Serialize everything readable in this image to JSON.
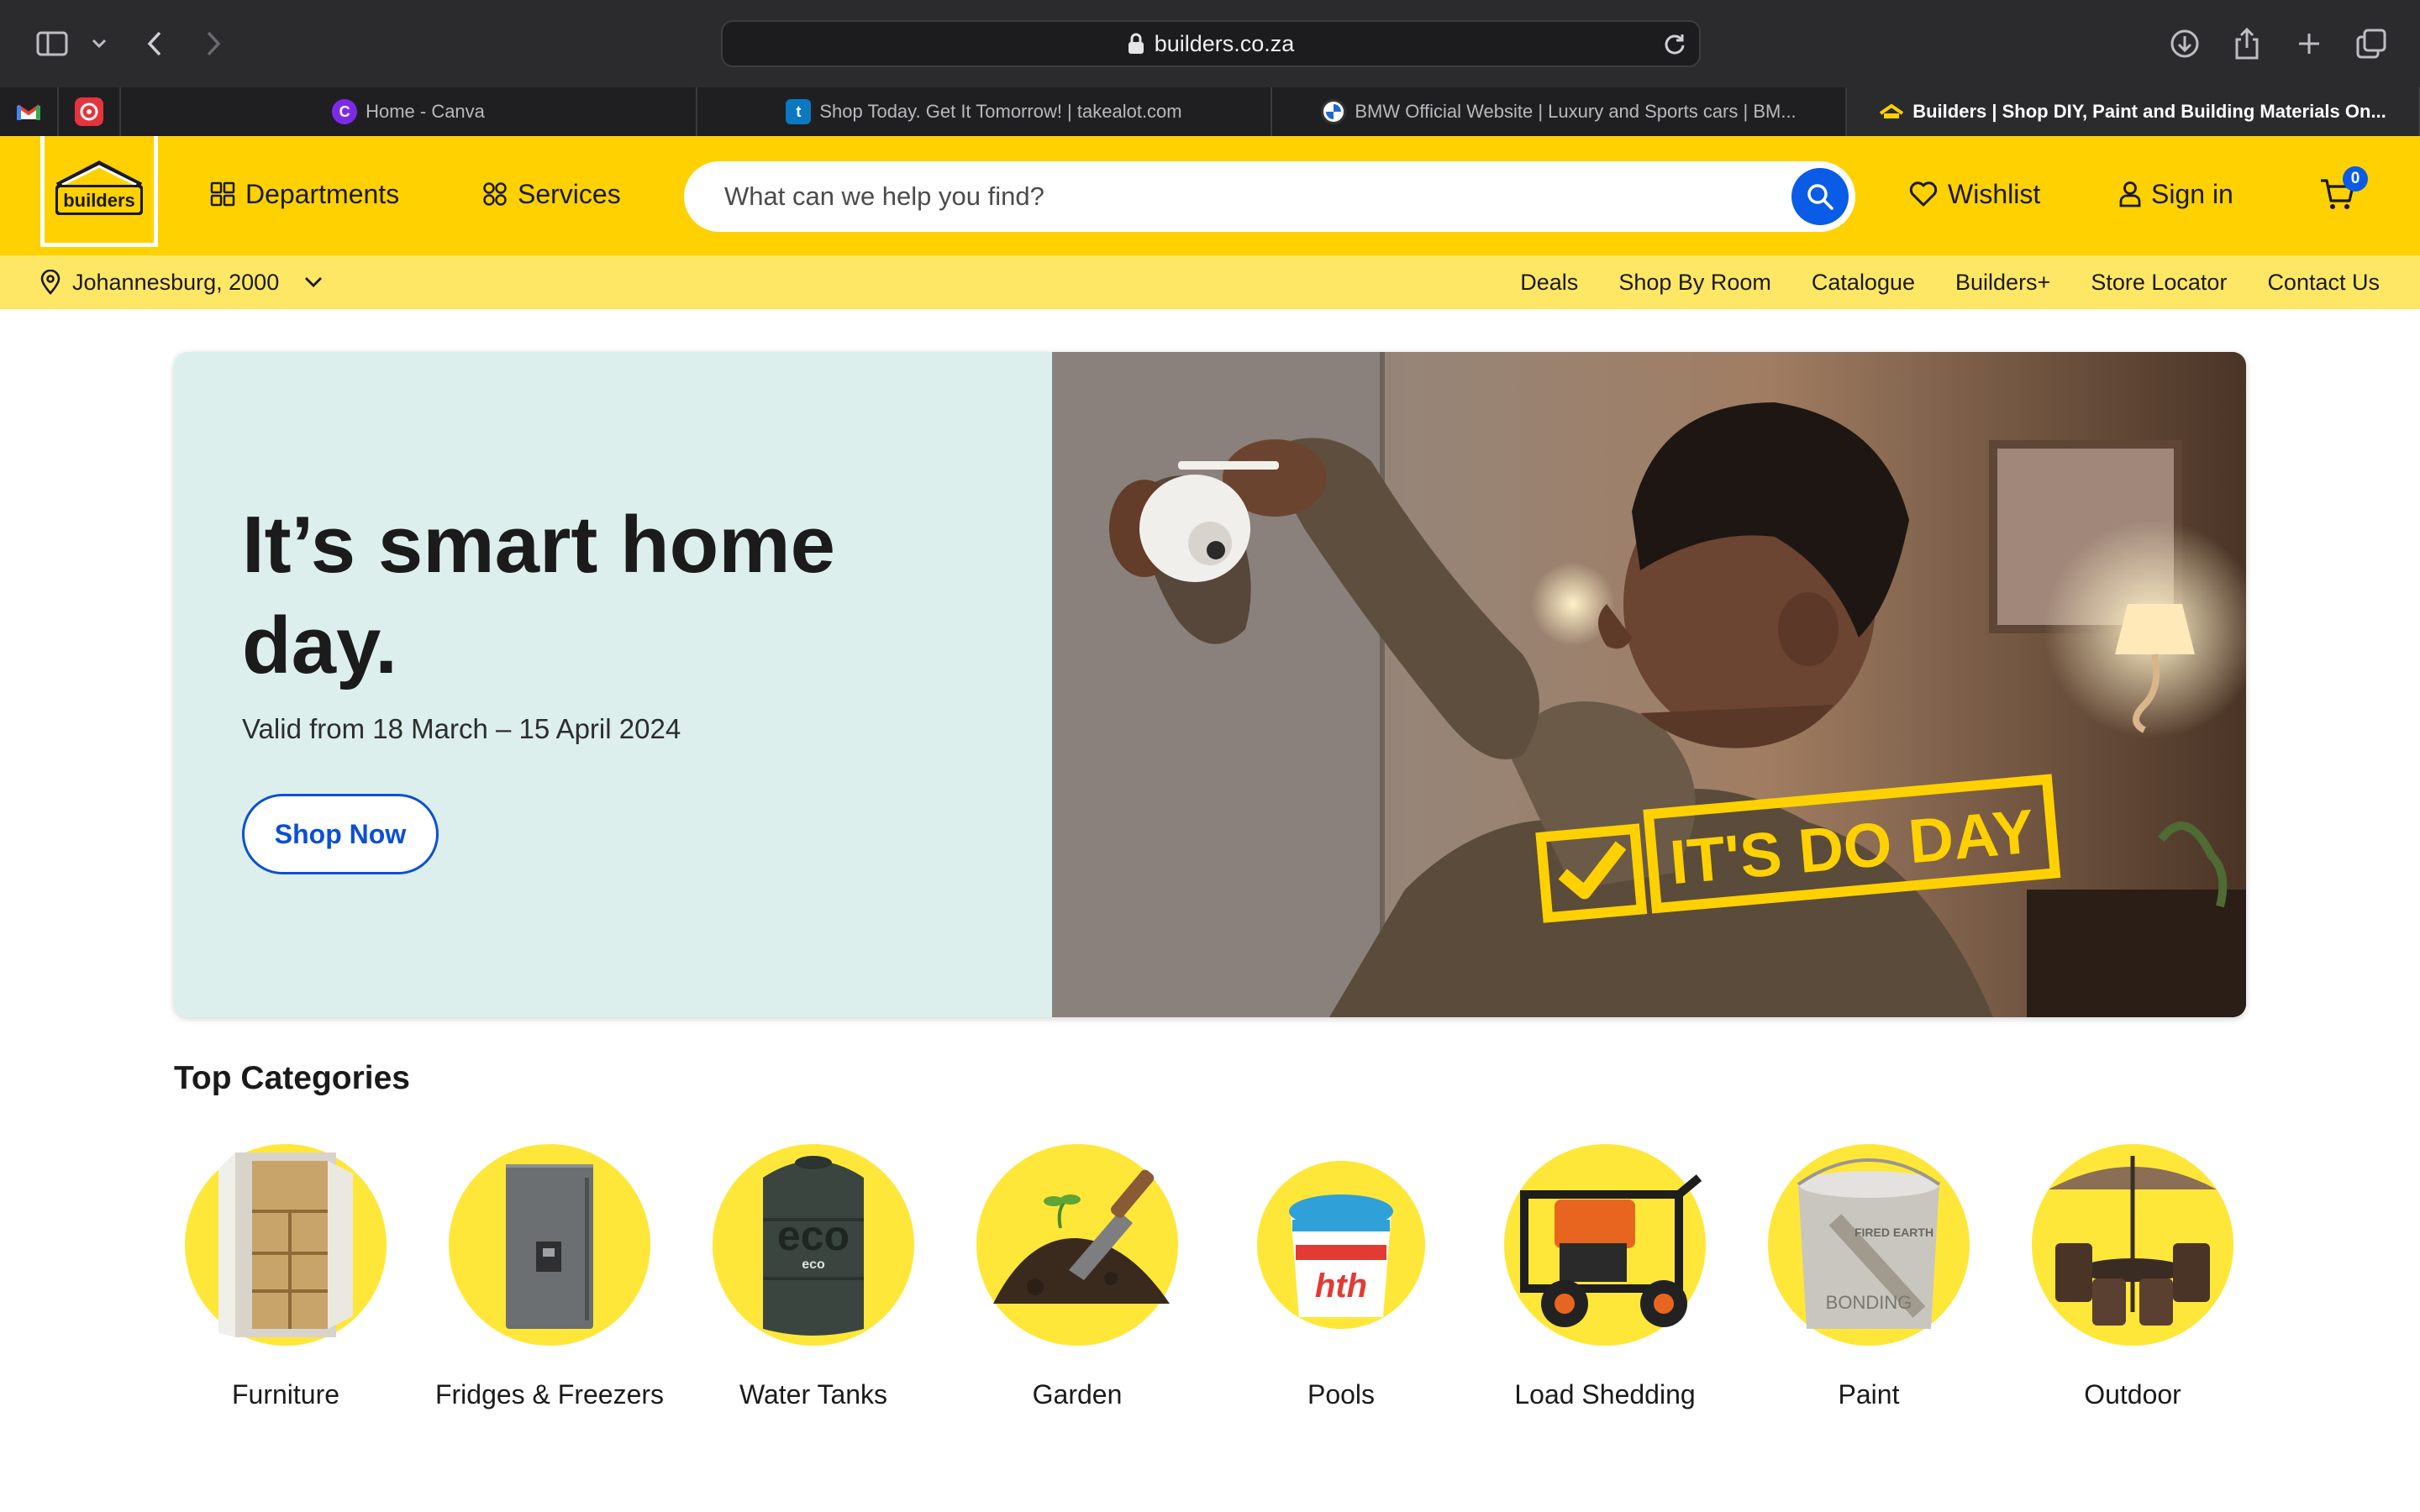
{
  "browser": {
    "url": "builders.co.za",
    "tabs": [
      {
        "title": "Home - Canva",
        "active": false
      },
      {
        "title": "Shop Today. Get It Tomorrow! | takealot.com",
        "active": false
      },
      {
        "title": "BMW Official Website | Luxury and Sports cars | BM...",
        "active": false
      },
      {
        "title": "Builders | Shop DIY, Paint and Building Materials On...",
        "active": true
      }
    ],
    "pinned_icons": [
      "gmail-icon",
      "app-icon"
    ]
  },
  "header": {
    "logo_text": "builders",
    "departments_label": "Departments",
    "services_label": "Services",
    "search_placeholder": "What can we help you find?",
    "wishlist_label": "Wishlist",
    "signin_label": "Sign in",
    "cart_count": "0"
  },
  "subbar": {
    "location": "Johannesburg, 2000",
    "links": [
      "Deals",
      "Shop By Room",
      "Catalogue",
      "Builders+",
      "Store Locator",
      "Contact Us"
    ]
  },
  "hero": {
    "title": "It’s smart home day.",
    "subtitle": "Valid from 18 March – 15 April 2024",
    "button": "Shop Now",
    "badge": "IT'S DO DAY"
  },
  "categories": {
    "title": "Top Categories",
    "items": [
      {
        "label": "Furniture",
        "icon": "cabinet-icon"
      },
      {
        "label": "Fridges & Freezers",
        "icon": "fridge-icon"
      },
      {
        "label": "Water Tanks",
        "icon": "water-tank-icon"
      },
      {
        "label": "Garden",
        "icon": "trowel-soil-icon"
      },
      {
        "label": "Pools",
        "icon": "pool-bucket-icon"
      },
      {
        "label": "Load Shedding",
        "icon": "generator-icon"
      },
      {
        "label": "Paint",
        "icon": "paint-bucket-icon"
      },
      {
        "label": "Outdoor",
        "icon": "patio-set-icon"
      }
    ]
  },
  "colors": {
    "brand_yellow": "#ffd100",
    "subbar_yellow": "#ffe766",
    "accent_blue": "#0a5ce6",
    "hero_bg": "#dcefec"
  }
}
